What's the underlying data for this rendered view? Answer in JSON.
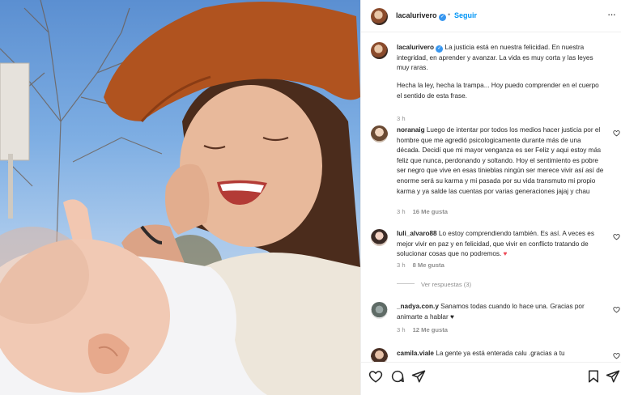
{
  "post": {
    "username": "lacalurivero",
    "separator": "•",
    "follow_label": "Seguir",
    "more_label": "···"
  },
  "caption": {
    "username": "lacalurivero",
    "text": "La justicia está en nuestra felicidad. En nuestra integridad, en aprender y avanzar. La vida es muy corta y las leyes muy raras.",
    "text2": "Hecha la ley, hecha la trampa... Hoy puedo comprender en el cuerpo el sentido de esta frase.",
    "time": "3 h"
  },
  "comments": [
    {
      "username": "noranaig",
      "text": "Luego de intentar por todos los medios hacer justicia por el hombre que me agredió psicologicamente durante más de una década. Decidí que mi mayor venganza es ser Feliz y aqui estoy más feliz que nunca, perdonando y soltando. Hoy el sentimiento es pobre ser negro que vive en esas tinieblas ningún ser merece vivir así así de enorme será su karma y mi pasada por su vida transmuto mi propio karma y ya salde las cuentas por varias generaciones jajaj y chau",
      "time": "3 h",
      "likes": "16 Me gusta"
    },
    {
      "username": "luli_alvaro88",
      "text": "Lo estoy comprendiendo también. Es así. A veces es mejor vivir en paz y en felicidad, que vivir en conflicto tratando de solucionar cosas que no podremos.",
      "emoji": "♥",
      "time": "3 h",
      "likes": "8 Me gusta",
      "replies_label": "Ver respuestas (3)"
    },
    {
      "username": "_nadya.con.y",
      "text": "Sanamos todas cuando lo hace una. Gracias por animarte a hablar",
      "emoji": "♥",
      "time": "3 h",
      "likes": "12 Me gusta"
    },
    {
      "username": "camila.viale",
      "text": "La gente ya está enterada calu .gracias a tu"
    }
  ],
  "icons": {
    "like": "heart-icon",
    "comment": "comment-icon",
    "share": "share-icon",
    "save": "bookmark-icon",
    "verified": "verified-badge-icon"
  },
  "colors": {
    "accent": "#0095f6",
    "verified": "#3897f0",
    "muted": "#8e8e8e",
    "like": "#ed4956"
  }
}
